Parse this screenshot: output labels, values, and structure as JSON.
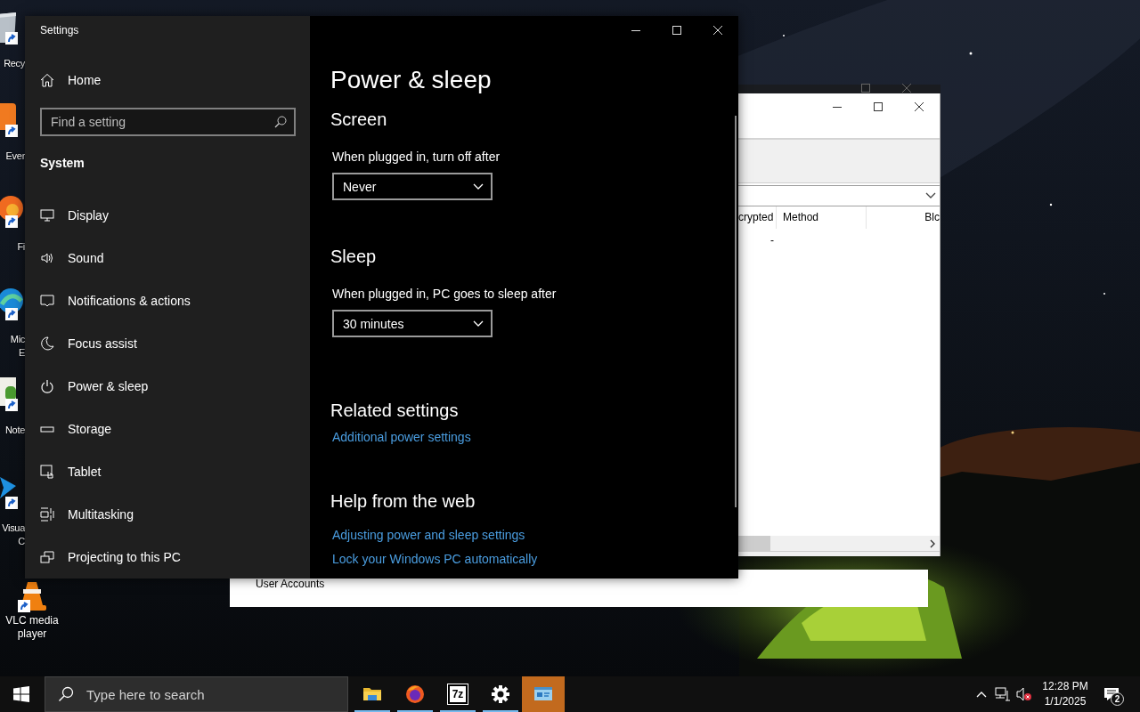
{
  "desktop_icons": [
    {
      "kind": "bin",
      "lines": [
        "Recy"
      ]
    },
    {
      "kind": "note",
      "lines": [
        "Ever"
      ]
    },
    {
      "kind": "browser",
      "lines": [
        "Fi"
      ]
    },
    {
      "kind": "edge",
      "lines": [
        "Mic",
        "E"
      ]
    },
    {
      "kind": "notepad",
      "lines": [
        "Note"
      ]
    },
    {
      "kind": "code",
      "lines": [
        "Visua",
        "C"
      ]
    },
    {
      "kind": "cone",
      "lines": [
        "VLC media",
        "player"
      ]
    }
  ],
  "back_window": {
    "columns": [
      "crypted",
      "Method",
      "Blc"
    ],
    "rows": [
      [
        "-"
      ]
    ]
  },
  "user_accounts_window": {
    "text": "User Accounts"
  },
  "settings_window": {
    "title": "Settings",
    "home": "Home",
    "search": {
      "placeholder": "Find a setting"
    },
    "section": "System",
    "nav": [
      {
        "kind": "display",
        "label": "Display"
      },
      {
        "kind": "sound",
        "label": "Sound"
      },
      {
        "kind": "notifications",
        "label": "Notifications & actions"
      },
      {
        "kind": "focus",
        "label": "Focus assist"
      },
      {
        "kind": "power",
        "label": "Power & sleep"
      },
      {
        "kind": "storage",
        "label": "Storage"
      },
      {
        "kind": "tablet",
        "label": "Tablet"
      },
      {
        "kind": "multitasking",
        "label": "Multitasking"
      },
      {
        "kind": "projecting",
        "label": "Projecting to this PC"
      }
    ],
    "page": {
      "title": "Power & sleep",
      "groups": [
        {
          "kind": "dropdown",
          "heading": "Screen",
          "label": "When plugged in, turn off after",
          "value": "Never"
        },
        {
          "kind": "dropdown",
          "heading": "Sleep",
          "label": "When plugged in, PC goes to sleep after",
          "value": "30 minutes"
        },
        {
          "kind": "links",
          "heading": "Related settings",
          "links": [
            "Additional power settings"
          ]
        },
        {
          "kind": "links",
          "heading": "Help from the web",
          "links": [
            "Adjusting power and sleep settings",
            "Lock your Windows PC automatically"
          ]
        }
      ]
    }
  },
  "taskbar": {
    "search": {
      "placeholder": "Type here to search"
    },
    "apps": [
      {
        "kind": "folder",
        "open": true,
        "selected": false
      },
      {
        "kind": "firefox",
        "open": true,
        "selected": false
      },
      {
        "kind": "archiver",
        "glyph": "7z",
        "open": true,
        "selected": false
      },
      {
        "kind": "gear",
        "open": true,
        "selected": false
      },
      {
        "kind": "control-panel",
        "open": false,
        "selected": true
      }
    ],
    "clock": {
      "time": "12:28 PM",
      "date": "1/1/2025"
    },
    "notifications": {
      "count": "2"
    }
  }
}
